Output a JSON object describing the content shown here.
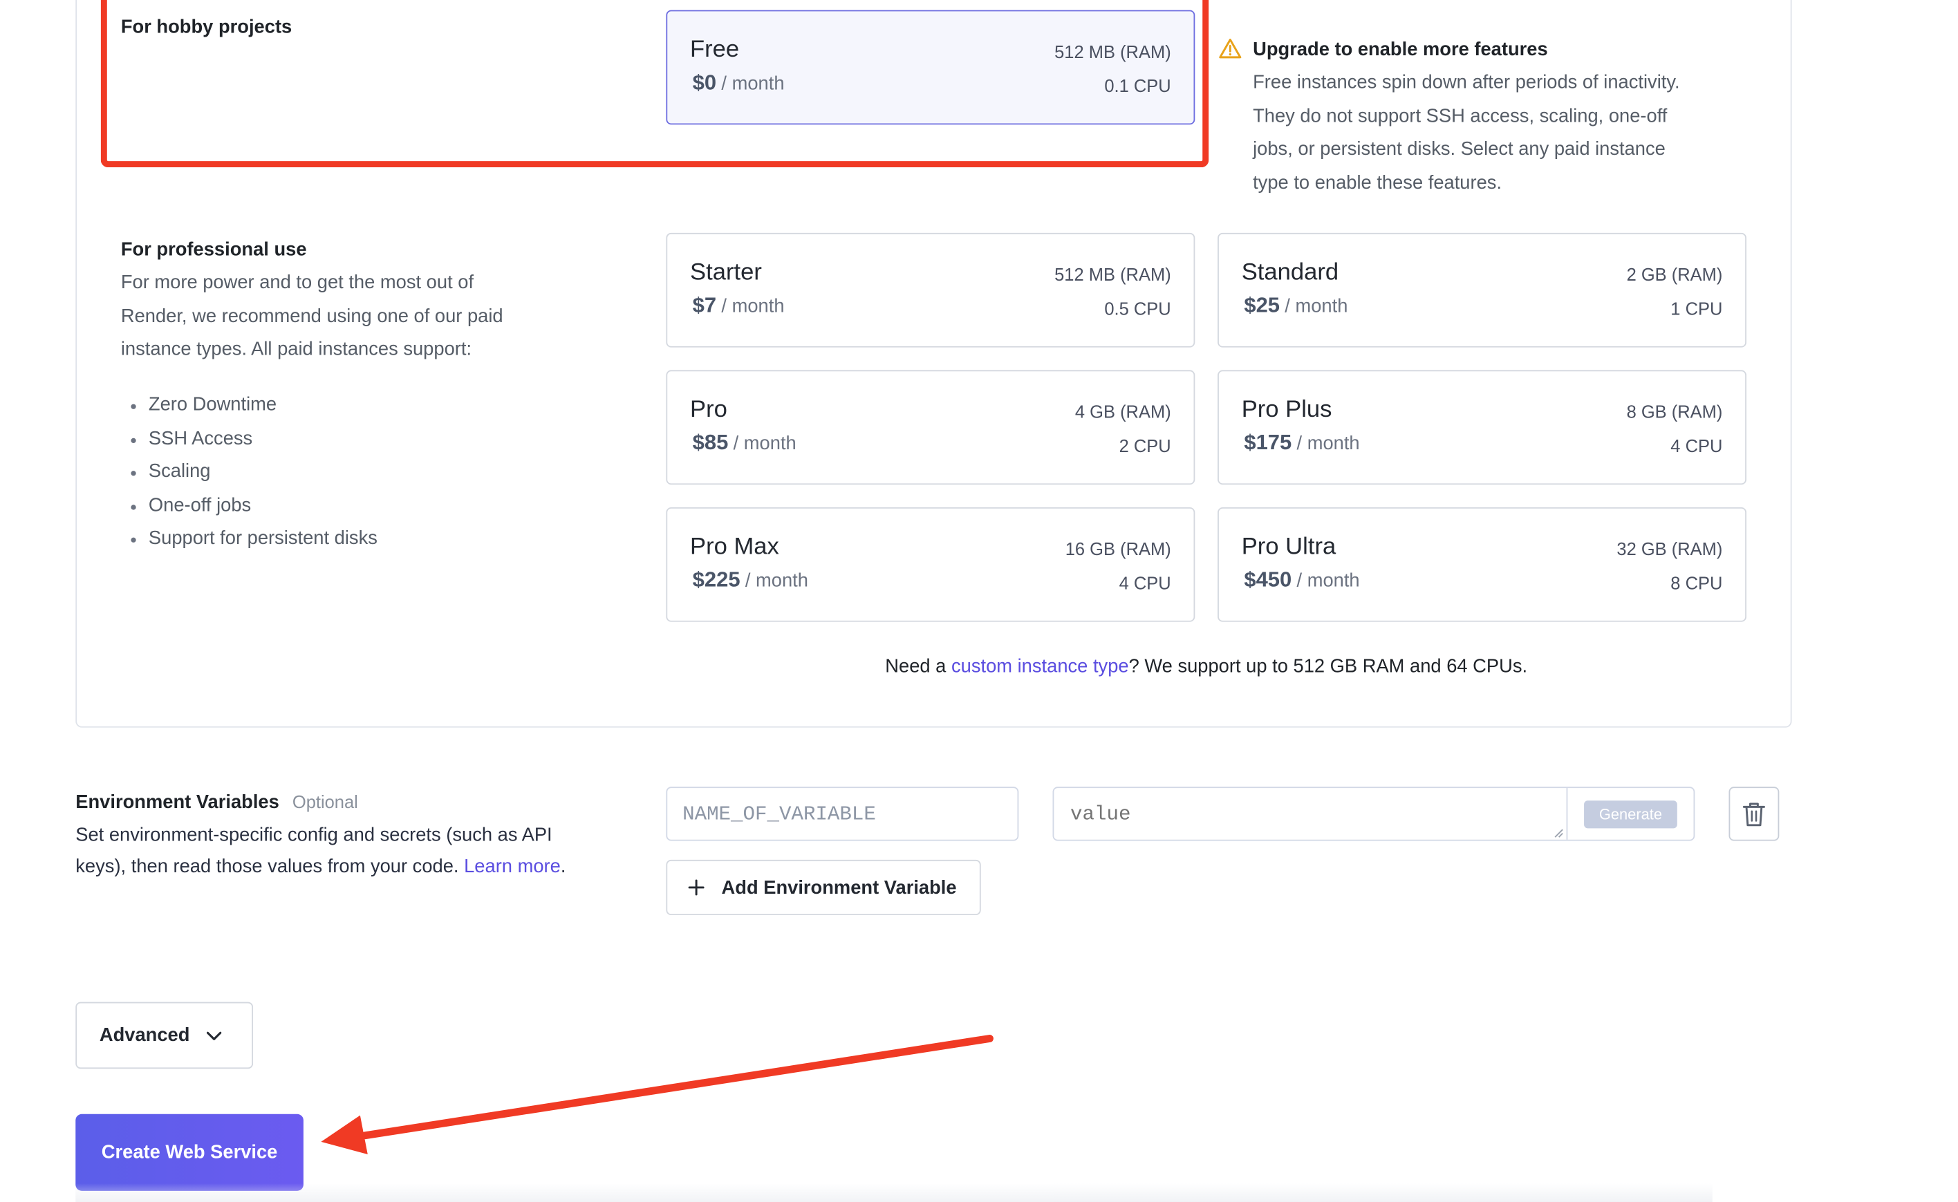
{
  "instance": {
    "hobby": {
      "heading": "For hobby projects",
      "warning_title": "Upgrade to enable more features",
      "warning_lines": [
        "Free instances spin down after periods of inactivity.",
        "They do not support SSH access, scaling, one-off",
        "jobs, or persistent disks. Select any paid instance",
        "type to enable these features."
      ]
    },
    "professional": {
      "heading": "For professional use",
      "description_lines": [
        "For more power and to get the most out of",
        "Render, we recommend using one of our paid",
        "instance types. All paid instances support:"
      ],
      "features": [
        "Zero Downtime",
        "SSH Access",
        "Scaling",
        "One-off jobs",
        "Support for persistent disks"
      ]
    },
    "plans": [
      {
        "name": "Free",
        "price": "$0",
        "per": "/ month",
        "ram": "512 MB (RAM)",
        "cpu": "0.1 CPU",
        "selected": true
      },
      {
        "name": "Starter",
        "price": "$7",
        "per": "/ month",
        "ram": "512 MB (RAM)",
        "cpu": "0.5 CPU"
      },
      {
        "name": "Standard",
        "price": "$25",
        "per": "/ month",
        "ram": "2 GB (RAM)",
        "cpu": "1 CPU"
      },
      {
        "name": "Pro",
        "price": "$85",
        "per": "/ month",
        "ram": "4 GB (RAM)",
        "cpu": "2 CPU"
      },
      {
        "name": "Pro Plus",
        "price": "$175",
        "per": "/ month",
        "ram": "8 GB (RAM)",
        "cpu": "4 CPU"
      },
      {
        "name": "Pro Max",
        "price": "$225",
        "per": "/ month",
        "ram": "16 GB (RAM)",
        "cpu": "4 CPU"
      },
      {
        "name": "Pro Ultra",
        "price": "$450",
        "per": "/ month",
        "ram": "32 GB (RAM)",
        "cpu": "8 CPU"
      }
    ],
    "custom_note": {
      "prefix": "Need a",
      "link": "custom instance type",
      "suffix": "? We support up to 512 GB RAM and 64 CPUs."
    }
  },
  "env": {
    "title": "Environment Variables",
    "optional": "Optional",
    "description_lines": [
      "Set environment-specific config and secrets (such as API",
      "keys), then read those values from your code."
    ],
    "learn_more": "Learn more",
    "learn_more_suffix": ".",
    "name_placeholder": "NAME_OF_VARIABLE",
    "value_placeholder": "value",
    "generate_label": "Generate",
    "add_label": "Add Environment Variable"
  },
  "advanced_label": "Advanced",
  "create_label": "Create Web Service",
  "colors": {
    "accent": "#5b5ee9",
    "link": "#5a4de0",
    "annotation": "#f03a24",
    "warning": "#e8a21a"
  },
  "icons": {
    "warning": "warning-triangle-icon",
    "trash": "trash-icon",
    "plus": "plus-icon",
    "chevron": "chevron-down-icon"
  }
}
